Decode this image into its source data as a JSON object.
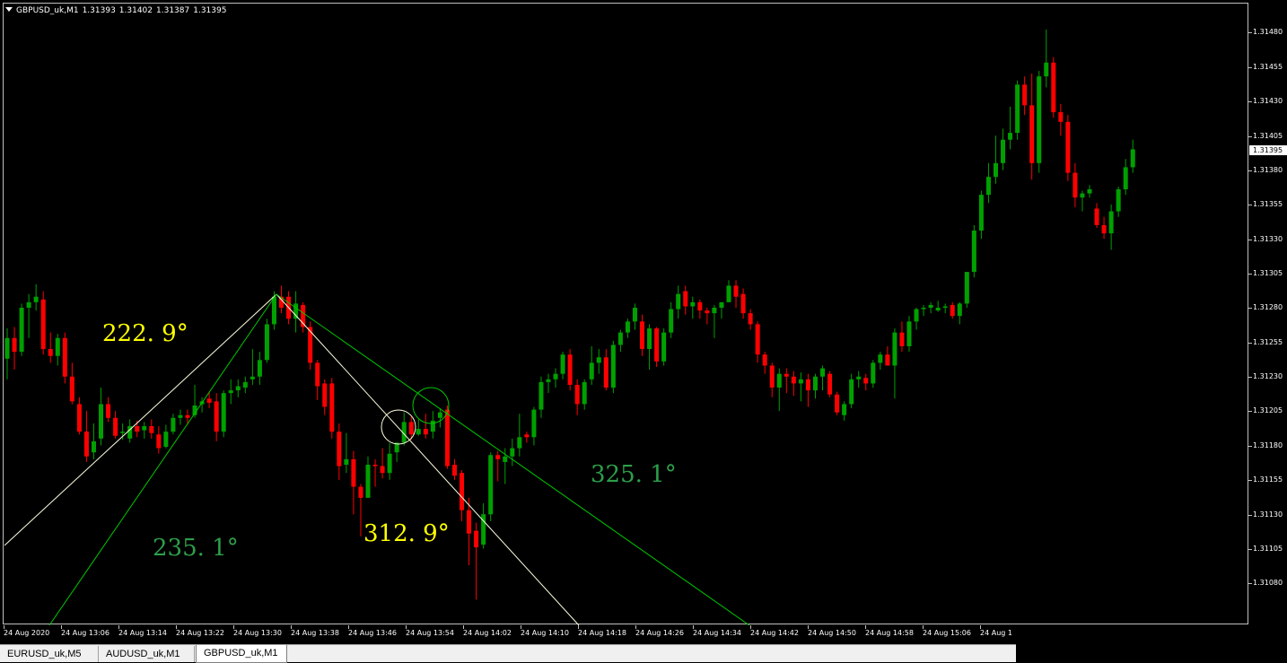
{
  "window": {
    "symbol_header": "GBPUSD_uk,M1",
    "ohlc": [
      "1.31393",
      "1.31402",
      "1.31387",
      "1.31395"
    ]
  },
  "price_axis": {
    "labels": [
      "1.31480",
      "1.31455",
      "1.31430",
      "1.31405",
      "1.31380",
      "1.31355",
      "1.31330",
      "1.31305",
      "1.31280",
      "1.31255",
      "1.31230",
      "1.31205",
      "1.31180",
      "1.31155",
      "1.31130",
      "1.31105",
      "1.31080"
    ],
    "current_price": "1.31395"
  },
  "time_axis": {
    "labels": [
      "24 Aug 2020",
      "24 Aug 13:06",
      "24 Aug 13:14",
      "24 Aug 13:22",
      "24 Aug 13:30",
      "24 Aug 13:38",
      "24 Aug 13:46",
      "24 Aug 13:54",
      "24 Aug 14:02",
      "24 Aug 14:10",
      "24 Aug 14:18",
      "24 Aug 14:26",
      "24 Aug 14:34",
      "24 Aug 14:42",
      "24 Aug 14:50",
      "24 Aug 14:58",
      "24 Aug 15:06",
      "24 Aug 1"
    ]
  },
  "annotations": {
    "angle_1": "222. 9°",
    "angle_2": "235. 1°",
    "angle_3": "312. 9°",
    "angle_4": "325. 1°",
    "colors": {
      "yellow": "#ffff00",
      "green": "#2e9e4a",
      "white_line": "#ffffe0",
      "green_line": "#00c800"
    }
  },
  "tabs": [
    {
      "label": "EURUSD_uk,M5",
      "active": false
    },
    {
      "label": "AUDUSD_uk,M1",
      "active": false
    },
    {
      "label": "GBPUSD_uk,M1",
      "active": true
    }
  ],
  "chart_colors": {
    "bull": "#00a000",
    "bear": "#ff0000",
    "doji": "#ffffff",
    "background": "#000000"
  },
  "chart_data": {
    "type": "candlestick",
    "symbol": "GBPUSD_uk",
    "timeframe": "M1",
    "candles": [
      [
        1.31243,
        1.31265,
        1.31228,
        1.31258
      ],
      [
        1.31258,
        1.31266,
        1.31235,
        1.31248
      ],
      [
        1.31248,
        1.31283,
        1.31245,
        1.3128
      ],
      [
        1.3128,
        1.3129,
        1.31258,
        1.31284
      ],
      [
        1.31284,
        1.31297,
        1.31278,
        1.31288
      ],
      [
        1.31286,
        1.31292,
        1.31246,
        1.3125
      ],
      [
        1.3125,
        1.31262,
        1.3124,
        1.31245
      ],
      [
        1.31245,
        1.31261,
        1.31238,
        1.31258
      ],
      [
        1.31258,
        1.31262,
        1.31225,
        1.3123
      ],
      [
        1.3123,
        1.3124,
        1.3121,
        1.31212
      ],
      [
        1.3121,
        1.31215,
        1.31188,
        1.3119
      ],
      [
        1.3119,
        1.31205,
        1.31168,
        1.31172
      ],
      [
        1.31175,
        1.31196,
        1.3117,
        1.31183
      ],
      [
        1.31185,
        1.31222,
        1.3118,
        1.3121
      ],
      [
        1.3121,
        1.31215,
        1.31197,
        1.312
      ],
      [
        1.312,
        1.31205,
        1.31185,
        1.31187
      ],
      [
        1.31189,
        1.31196,
        1.31184,
        1.3119
      ],
      [
        1.31185,
        1.31199,
        1.31182,
        1.31194
      ],
      [
        1.31194,
        1.31198,
        1.31186,
        1.3119
      ],
      [
        1.31191,
        1.31197,
        1.31185,
        1.31194
      ],
      [
        1.31194,
        1.31199,
        1.31185,
        1.31189
      ],
      [
        1.31188,
        1.31194,
        1.31174,
        1.31178
      ],
      [
        1.31179,
        1.31195,
        1.31178,
        1.3119
      ],
      [
        1.3119,
        1.31203,
        1.31188,
        1.312
      ],
      [
        1.312,
        1.31206,
        1.31195,
        1.31202
      ],
      [
        1.31202,
        1.31206,
        1.31195,
        1.312
      ],
      [
        1.31202,
        1.31224,
        1.312,
        1.31209
      ],
      [
        1.3121,
        1.31215,
        1.31204,
        1.31212
      ],
      [
        1.31214,
        1.31219,
        1.31207,
        1.31211
      ],
      [
        1.31212,
        1.31218,
        1.31183,
        1.3119
      ],
      [
        1.3119,
        1.3122,
        1.31186,
        1.31218
      ],
      [
        1.31218,
        1.31228,
        1.3121,
        1.3122
      ],
      [
        1.3122,
        1.31228,
        1.31215,
        1.31223
      ],
      [
        1.31222,
        1.3123,
        1.31218,
        1.31226
      ],
      [
        1.31228,
        1.3125,
        1.31224,
        1.3123
      ],
      [
        1.3123,
        1.31248,
        1.31224,
        1.31242
      ],
      [
        1.31242,
        1.31272,
        1.3124,
        1.31268
      ],
      [
        1.31268,
        1.31292,
        1.31264,
        1.31288
      ],
      [
        1.31288,
        1.31296,
        1.31276,
        1.3128
      ],
      [
        1.31288,
        1.31292,
        1.31268,
        1.31272
      ],
      [
        1.31272,
        1.31292,
        1.31262,
        1.31283
      ],
      [
        1.31282,
        1.31284,
        1.31262,
        1.31266
      ],
      [
        1.31266,
        1.3127,
        1.31235,
        1.3124
      ],
      [
        1.3124,
        1.31242,
        1.31213,
        1.31223
      ],
      [
        1.31225,
        1.31228,
        1.31202,
        1.31208
      ],
      [
        1.31225,
        1.31229,
        1.31185,
        1.3119
      ],
      [
        1.3119,
        1.31196,
        1.31155,
        1.31165
      ],
      [
        1.31166,
        1.31189,
        1.3116,
        1.3117
      ],
      [
        1.3117,
        1.31176,
        1.3113,
        1.3115
      ],
      [
        1.3115,
        1.31152,
        1.31114,
        1.31142
      ],
      [
        1.31142,
        1.31172,
        1.31142,
        1.31166
      ],
      [
        1.31166,
        1.3117,
        1.3115,
        1.31165
      ],
      [
        1.31165,
        1.31178,
        1.31156,
        1.3116
      ],
      [
        1.3116,
        1.31182,
        1.31155,
        1.31174
      ],
      [
        1.31175,
        1.31182,
        1.31168,
        1.31182
      ],
      [
        1.31182,
        1.31204,
        1.3118,
        1.31197
      ],
      [
        1.31197,
        1.31201,
        1.31184,
        1.31188
      ],
      [
        1.31188,
        1.31199,
        1.31187,
        1.31192
      ],
      [
        1.31192,
        1.31203,
        1.31185,
        1.31188
      ],
      [
        1.3119,
        1.31205,
        1.31185,
        1.31198
      ],
      [
        1.312,
        1.31207,
        1.31193,
        1.31204
      ],
      [
        1.31206,
        1.31209,
        1.31163,
        1.31165
      ],
      [
        1.31166,
        1.3117,
        1.31155,
        1.31158
      ],
      [
        1.3116,
        1.31162,
        1.31125,
        1.31133
      ],
      [
        1.31133,
        1.31142,
        1.31093,
        1.31116
      ],
      [
        1.31118,
        1.31124,
        1.31068,
        1.31106
      ],
      [
        1.31108,
        1.31138,
        1.31105,
        1.3113
      ],
      [
        1.3113,
        1.31175,
        1.31125,
        1.31173
      ],
      [
        1.31173,
        1.31176,
        1.31154,
        1.3117
      ],
      [
        1.31168,
        1.31178,
        1.31152,
        1.31172
      ],
      [
        1.31172,
        1.31185,
        1.31165,
        1.31178
      ],
      [
        1.31178,
        1.31203,
        1.31172,
        1.31186
      ],
      [
        1.31188,
        1.3119,
        1.31182,
        1.31186
      ],
      [
        1.31186,
        1.31208,
        1.3118,
        1.31206
      ],
      [
        1.31206,
        1.3123,
        1.312,
        1.31226
      ],
      [
        1.31226,
        1.31232,
        1.31218,
        1.31228
      ],
      [
        1.31228,
        1.31236,
        1.31222,
        1.31232
      ],
      [
        1.31232,
        1.31248,
        1.31228,
        1.31246
      ],
      [
        1.31246,
        1.3125,
        1.3122,
        1.31224
      ],
      [
        1.31224,
        1.31228,
        1.31202,
        1.3121
      ],
      [
        1.3121,
        1.31228,
        1.31206,
        1.31226
      ],
      [
        1.31228,
        1.31252,
        1.31224,
        1.3124
      ],
      [
        1.3124,
        1.3125,
        1.31232,
        1.31244
      ],
      [
        1.31244,
        1.3125,
        1.3122,
        1.31222
      ],
      [
        1.31222,
        1.31256,
        1.31218,
        1.31253
      ],
      [
        1.31253,
        1.31264,
        1.31248,
        1.31262
      ],
      [
        1.31262,
        1.31272,
        1.31258,
        1.3127
      ],
      [
        1.3127,
        1.31283,
        1.31264,
        1.3128
      ],
      [
        1.3127,
        1.31275,
        1.31245,
        1.3125
      ],
      [
        1.3125,
        1.31268,
        1.31235,
        1.31265
      ],
      [
        1.31265,
        1.31266,
        1.31237,
        1.31241
      ],
      [
        1.31241,
        1.31265,
        1.31238,
        1.31262
      ],
      [
        1.31262,
        1.31284,
        1.31258,
        1.31279
      ],
      [
        1.31279,
        1.31296,
        1.31272,
        1.3129
      ],
      [
        1.31292,
        1.31296,
        1.31275,
        1.31281
      ],
      [
        1.31281,
        1.31288,
        1.31272,
        1.31284
      ],
      [
        1.31284,
        1.31286,
        1.31272,
        1.31278
      ],
      [
        1.31278,
        1.3128,
        1.31268,
        1.31276
      ],
      [
        1.31276,
        1.31282,
        1.31258,
        1.3128
      ],
      [
        1.3128,
        1.31284,
        1.31272,
        1.31284
      ],
      [
        1.31284,
        1.313,
        1.31284,
        1.31296
      ],
      [
        1.31296,
        1.313,
        1.3128,
        1.31288
      ],
      [
        1.3129,
        1.31294,
        1.31272,
        1.31276
      ],
      [
        1.31276,
        1.31279,
        1.31264,
        1.31268
      ],
      [
        1.31268,
        1.3127,
        1.3124,
        1.31246
      ],
      [
        1.31246,
        1.31248,
        1.31232,
        1.31238
      ],
      [
        1.31238,
        1.3124,
        1.31215,
        1.31222
      ],
      [
        1.31222,
        1.31236,
        1.31205,
        1.31232
      ],
      [
        1.31232,
        1.31236,
        1.31218,
        1.3123
      ],
      [
        1.3123,
        1.31234,
        1.31216,
        1.31225
      ],
      [
        1.31225,
        1.31233,
        1.31212,
        1.31228
      ],
      [
        1.31228,
        1.31232,
        1.31208,
        1.3122
      ],
      [
        1.3122,
        1.31232,
        1.31214,
        1.3123
      ],
      [
        1.3123,
        1.31238,
        1.3122,
        1.31236
      ],
      [
        1.31232,
        1.31234,
        1.31215,
        1.31217
      ],
      [
        1.31217,
        1.31219,
        1.31202,
        1.31204
      ],
      [
        1.31202,
        1.31212,
        1.31198,
        1.3121
      ],
      [
        1.3121,
        1.31232,
        1.31207,
        1.31228
      ],
      [
        1.31228,
        1.31234,
        1.31222,
        1.3123
      ],
      [
        1.31229,
        1.31232,
        1.3122,
        1.31225
      ],
      [
        1.31225,
        1.31242,
        1.31222,
        1.3124
      ],
      [
        1.3124,
        1.31248,
        1.31235,
        1.31246
      ],
      [
        1.31246,
        1.31252,
        1.31238,
        1.31238
      ],
      [
        1.31238,
        1.31265,
        1.31214,
        1.31262
      ],
      [
        1.31262,
        1.3127,
        1.31248,
        1.31252
      ],
      [
        1.31252,
        1.31274,
        1.31248,
        1.3127
      ],
      [
        1.3127,
        1.3128,
        1.31264,
        1.31279
      ],
      [
        1.31279,
        1.31282,
        1.31274,
        1.3128
      ],
      [
        1.3128,
        1.31284,
        1.31276,
        1.31282
      ],
      [
        1.31278,
        1.31285,
        1.31277,
        1.3128
      ],
      [
        1.3128,
        1.31283,
        1.31276,
        1.31281
      ],
      [
        1.31282,
        1.31284,
        1.31272,
        1.31274
      ],
      [
        1.31274,
        1.31284,
        1.31268,
        1.31283
      ],
      [
        1.31283,
        1.31306,
        1.3128,
        1.31306
      ],
      [
        1.31306,
        1.3134,
        1.31302,
        1.31336
      ],
      [
        1.31336,
        1.31365,
        1.3133,
        1.31362
      ],
      [
        1.31362,
        1.31385,
        1.31356,
        1.31375
      ],
      [
        1.31375,
        1.31405,
        1.3137,
        1.31385
      ],
      [
        1.31385,
        1.3141,
        1.3138,
        1.31402
      ],
      [
        1.31402,
        1.31426,
        1.31395,
        1.31407
      ],
      [
        1.31407,
        1.31445,
        1.31402,
        1.31442
      ],
      [
        1.31442,
        1.31448,
        1.3142,
        1.31427
      ],
      [
        1.31427,
        1.3145,
        1.31373,
        1.31385
      ],
      [
        1.31385,
        1.31452,
        1.31378,
        1.31448
      ],
      [
        1.31448,
        1.31482,
        1.3144,
        1.31458
      ],
      [
        1.31458,
        1.31462,
        1.31418,
        1.31422
      ],
      [
        1.31422,
        1.31428,
        1.31405,
        1.31415
      ],
      [
        1.31415,
        1.3142,
        1.31372,
        1.31378
      ],
      [
        1.31378,
        1.31385,
        1.31353,
        1.3136
      ],
      [
        1.3136,
        1.31365,
        1.3135,
        1.31363
      ],
      [
        1.31363,
        1.31369,
        1.3136,
        1.31366
      ],
      [
        1.31352,
        1.31356,
        1.31338,
        1.3134
      ],
      [
        1.3134,
        1.31346,
        1.3133,
        1.31334
      ],
      [
        1.31334,
        1.31355,
        1.31322,
        1.3135
      ],
      [
        1.3135,
        1.31368,
        1.31346,
        1.31366
      ],
      [
        1.31366,
        1.31388,
        1.31362,
        1.31382
      ],
      [
        1.31382,
        1.31402,
        1.31378,
        1.31395
      ]
    ]
  }
}
